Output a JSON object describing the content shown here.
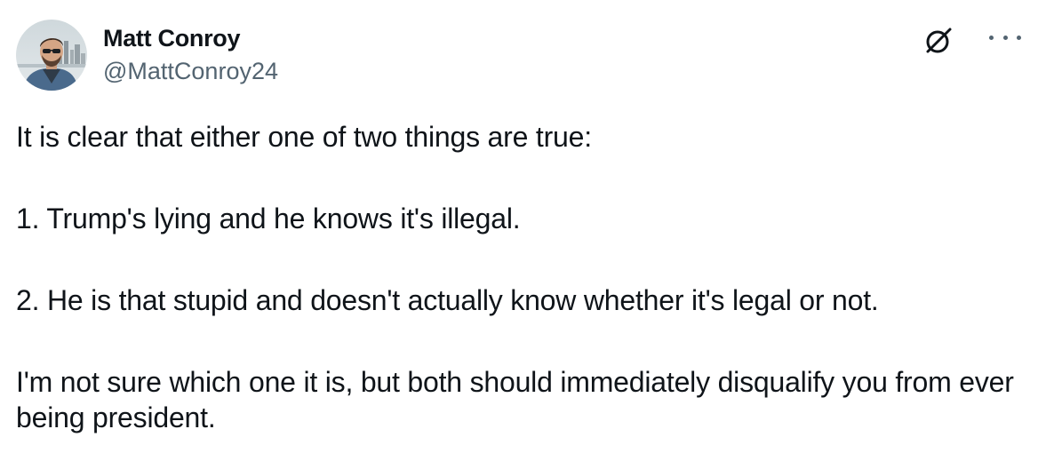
{
  "author": {
    "display_name": "Matt Conroy",
    "handle": "@MattConroy24"
  },
  "icons": {
    "grok": "grok-icon",
    "more": "more-options-icon"
  },
  "tweet": {
    "line_intro": "It is clear that either one of two things are true:",
    "line_1": "1. Trump's lying and he knows it's illegal.",
    "line_2": "2. He is that stupid and doesn't actually know whether it's legal or not.",
    "line_conclusion": "I'm not sure which one it is, but both should immediately disqualify you from ever being president."
  },
  "colors": {
    "text": "#0f1419",
    "secondary": "#536471",
    "background": "#ffffff"
  }
}
